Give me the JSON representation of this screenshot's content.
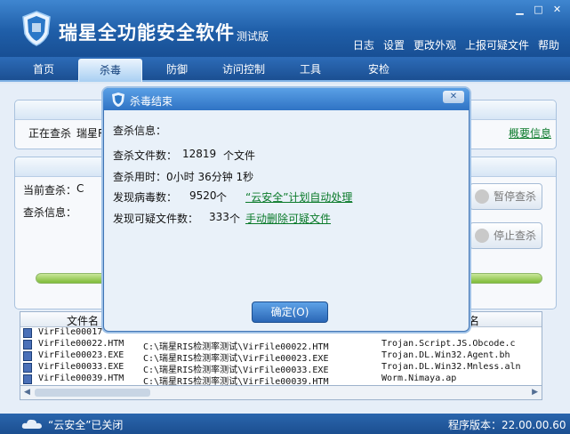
{
  "app": {
    "title": "瑞星全功能安全软件",
    "subtitle": "测试版",
    "top_links": [
      "日志",
      "设置",
      "更改外观",
      "上报可疑文件",
      "帮助"
    ]
  },
  "nav": {
    "tabs": [
      "首页",
      "杀毒",
      "防御",
      "访问控制",
      "工具",
      "安检"
    ],
    "active": "杀毒"
  },
  "scan_panel": {
    "status_prefix": "正在查杀",
    "status_target_partial": "瑞星R",
    "summary_link": "概要信息"
  },
  "detail_panel": {
    "current_label": "当前查杀：",
    "current_value": "C",
    "info_label": "查杀信息：",
    "pause_button": "暂停查杀",
    "stop_button": "停止查杀"
  },
  "table": {
    "col_filename": "文件名",
    "col_virusname_partial": "名",
    "rows": [
      {
        "file": "VirFile00017",
        "path": "",
        "virus": ""
      },
      {
        "file": "VirFile00022.HTM",
        "path": "C:\\瑞星RIS检测率测试\\VirFile00022.HTM",
        "virus": "Trojan.Script.JS.Obcode.c"
      },
      {
        "file": "VirFile00023.EXE",
        "path": "C:\\瑞星RIS检测率测试\\VirFile00023.EXE",
        "virus": "Trojan.DL.Win32.Agent.bh"
      },
      {
        "file": "VirFile00033.EXE",
        "path": "C:\\瑞星RIS检测率测试\\VirFile00033.EXE",
        "virus": "Trojan.DL.Win32.Mnless.aln"
      },
      {
        "file": "VirFile00039.HTM",
        "path": "C:\\瑞星RIS检测率测试\\VirFile00039.HTM",
        "virus": "Worm.Nimaya.ap"
      }
    ]
  },
  "status_bar": {
    "cloud_status": "“云安全”已关闭",
    "version": "程序版本：22.00.00.60"
  },
  "dialog": {
    "title": "杀毒结束",
    "info_heading": "查杀信息：",
    "files_label": "查杀文件数：",
    "files_value": "12819",
    "files_unit": "个文件",
    "time_label": "查杀用时：",
    "time_value": "0小时 36分钟 1秒",
    "virus_label": "发现病毒数：",
    "virus_value": "9520",
    "virus_unit": "个",
    "virus_link": "“云安全”计划自动处理",
    "suspicious_label": "发现可疑文件数：",
    "suspicious_value": "333",
    "suspicious_unit": "个",
    "suspicious_link": "手动删除可疑文件",
    "ok_button": "确定(O)"
  },
  "colors": {
    "header_blue": "#1f5ea8",
    "link_green": "#0a7a2a",
    "progress_green": "#7ebb37"
  }
}
